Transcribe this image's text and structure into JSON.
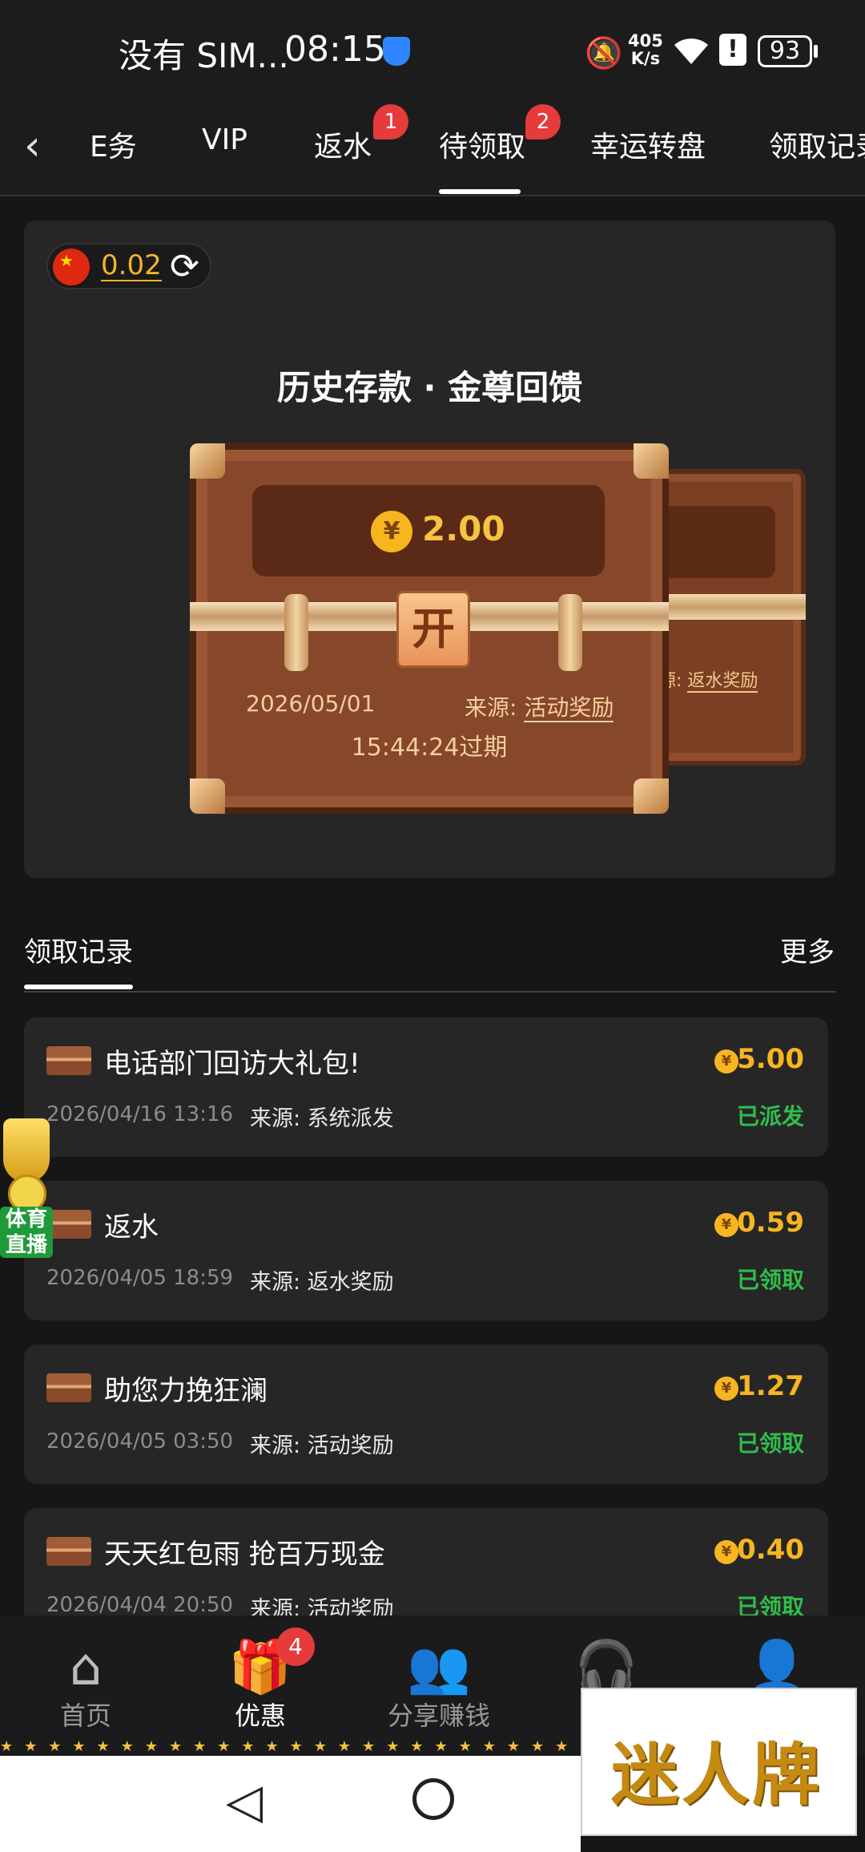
{
  "status_bar": {
    "carrier": "没有 SIM...",
    "time": "08:15",
    "net_speed_value": "405",
    "net_speed_unit": "K/s",
    "battery": "93"
  },
  "tabs": [
    {
      "label": "E务",
      "badge": ""
    },
    {
      "label": "VIP",
      "badge": ""
    },
    {
      "label": "返水",
      "badge": "1"
    },
    {
      "label": "待领取",
      "badge": "2",
      "active": true
    },
    {
      "label": "幸运转盘",
      "badge": ""
    },
    {
      "label": "领取记录",
      "badge": ""
    }
  ],
  "balance": {
    "value": "0.02"
  },
  "card": {
    "title": "历史存款 · 金尊回馈",
    "amount": "2.00",
    "currency_symbol": "¥",
    "lock_label": "开",
    "date": "2026/05/01",
    "expire": "15:44:24过期",
    "source_label": "来源:",
    "source_value": "活动奖励",
    "back_source_label": "源:",
    "back_source_value": "返水奖励"
  },
  "records": {
    "header": "领取记录",
    "more": "更多",
    "items": [
      {
        "title": "电话部门回访大礼包!",
        "amount": "5.00",
        "date": "2026/04/16 13:16",
        "source": "来源: 系统派发",
        "status": "已派发"
      },
      {
        "title": "返水",
        "amount": "0.59",
        "date": "2026/04/05 18:59",
        "source": "来源: 返水奖励",
        "status": "已领取"
      },
      {
        "title": "助您力挽狂澜",
        "amount": "1.27",
        "date": "2026/04/05 03:50",
        "source": "来源: 活动奖励",
        "status": "已领取"
      },
      {
        "title": "天天红包雨 抢百万现金",
        "amount": "0.40",
        "date": "2026/04/04 20:50",
        "source": "来源: 活动奖励",
        "status": "已领取"
      }
    ]
  },
  "sports_widget": {
    "label": "体育直播"
  },
  "bottom_nav": {
    "items": [
      {
        "label": "首页",
        "icon": "home-icon"
      },
      {
        "label": "优惠",
        "icon": "gift-icon",
        "active": true
      },
      {
        "label": "分享赚钱",
        "icon": "share-icon"
      },
      {
        "label": "",
        "icon": "headset-icon"
      },
      {
        "label": "",
        "icon": "profile-icon"
      }
    ],
    "promo_badge": "4"
  },
  "logo": {
    "text": "迷人牌"
  },
  "colors": {
    "accent_gold": "#f7b520",
    "status_green": "#2fbe4c",
    "badge_red": "#e53b3b",
    "background": "#161616",
    "card": "#262626"
  }
}
